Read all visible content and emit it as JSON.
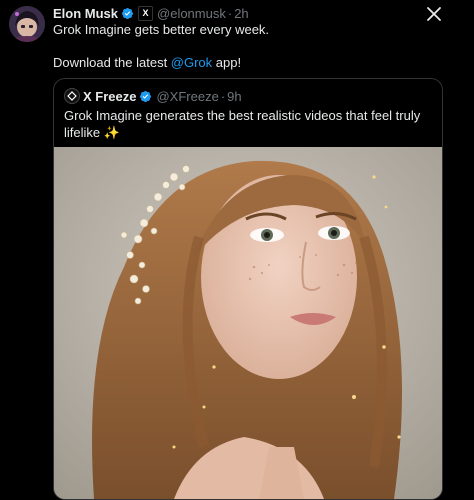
{
  "post": {
    "author_name": "Elon Musk",
    "author_handle": "@elonmusk",
    "separator": "·",
    "timestamp": "2h",
    "text_line1": "Grok Imagine gets better every week.",
    "text_line2_before": "Download the latest ",
    "text_line2_mention": "@Grok",
    "text_line2_after": " app!"
  },
  "quoted_post": {
    "author_name": "X Freeze",
    "author_handle": "@XFreeze",
    "separator": "·",
    "timestamp": "9h",
    "text": "Grok Imagine generates the best realistic videos that feel truly lifelike ✨",
    "media_alt": "AI-generated portrait"
  },
  "icons": {
    "verified": "verified-badge-icon",
    "affiliate": "x-affiliate-icon",
    "close": "close-icon"
  },
  "colors": {
    "background": "#000000",
    "text": "#e7e9ea",
    "secondary_text": "#71767b",
    "link": "#1d9bf0",
    "verified": "#1d9bf0",
    "border": "#2f3336"
  }
}
